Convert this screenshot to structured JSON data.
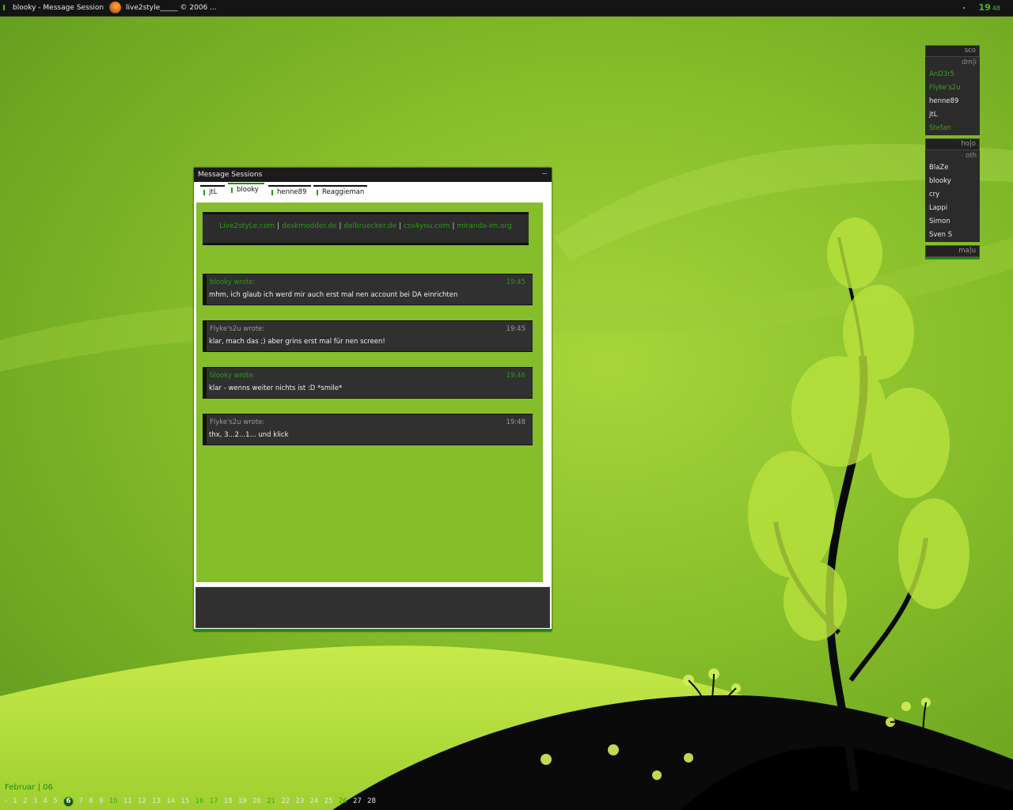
{
  "colors": {
    "accent": "#4cbb1e",
    "online": "#3aa415",
    "panel": "#303030",
    "bar": "#141414"
  },
  "taskbar": {
    "items": [
      "blooky - Message Session",
      "live2style_____ © 2006 ..."
    ],
    "clock": {
      "hour": "19",
      "minute": "48"
    }
  },
  "contacts": {
    "groups": [
      {
        "label": "sco",
        "sub": "dm|i",
        "items": [
          {
            "name": "AnD3r5",
            "online": true
          },
          {
            "name": "Flyke's2u",
            "online": true
          },
          {
            "name": "henne89",
            "online": false
          },
          {
            "name": "jtL",
            "online": false
          },
          {
            "name": "Stefan",
            "online": true
          }
        ]
      },
      {
        "label": "ho|o",
        "sub": "oth",
        "items": [
          {
            "name": "BlaZe",
            "online": false
          },
          {
            "name": "blooky",
            "online": false
          },
          {
            "name": "cry",
            "online": false
          },
          {
            "name": "Lappi",
            "online": false
          },
          {
            "name": "Simon",
            "online": false
          },
          {
            "name": "Sven S",
            "online": false
          }
        ]
      },
      {
        "label": "ma|u"
      }
    ]
  },
  "window": {
    "title": "Message Sessions",
    "tabs": [
      "jtL",
      "blooky",
      "henne89",
      "Reaggieman"
    ],
    "active_tab": "blooky",
    "links": [
      "Live2styLe.com",
      "deskmodder.de",
      "delbruecker.de",
      "css4you.com",
      "miranda-im.org"
    ],
    "link_separator": "|",
    "messages": [
      {
        "who": "blooky wrote:",
        "time": "19:45",
        "text": "mhm, ich glaub ich werd mir auch erst mal nen account bei DA einrichten",
        "self": true
      },
      {
        "who": "Flyke's2u wrote:",
        "time": "19:45",
        "text": "klar, mach das ;) aber grins erst mal für nen screen!",
        "self": false
      },
      {
        "who": "blooky wrote:",
        "time": "19:46",
        "text": "klar - wenns weiter nichts ist :D *smile*",
        "self": true
      },
      {
        "who": "Flyke's2u wrote:",
        "time": "19:48",
        "text": "thx, 3...2...1... und klick",
        "self": false
      }
    ],
    "input_value": ""
  },
  "calendar": {
    "title": "Februar | 06",
    "prefix": "-",
    "days": [
      "1",
      "2",
      "3",
      "4",
      "5",
      "6",
      "7",
      "8",
      "9",
      "10",
      "11",
      "12",
      "13",
      "14",
      "15",
      "16",
      "17",
      "18",
      "19",
      "20",
      "21",
      "22",
      "23",
      "24",
      "25",
      "26",
      "27",
      "28"
    ],
    "today": "6",
    "highlighted": [
      "10",
      "16",
      "17",
      "21",
      "26"
    ]
  }
}
